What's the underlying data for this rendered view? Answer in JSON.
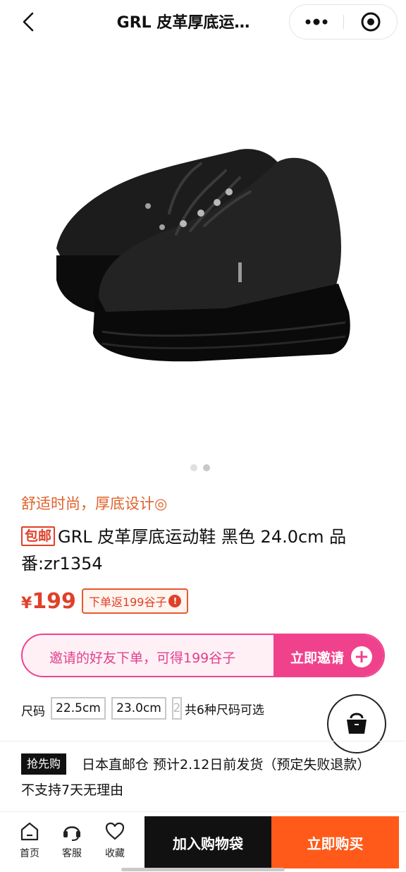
{
  "header": {
    "title": "GRL 皮革厚底运…"
  },
  "gallery": {
    "image_count": 2,
    "active_index": 1
  },
  "product": {
    "slogan": "舒适时尚，厚底设计◎",
    "badge": "包邮",
    "name": "GRL 皮革厚底运动鞋 黑色 24.0cm 品番:zr1354",
    "price_symbol": "¥",
    "price": "199",
    "rebate": "下单返199谷子",
    "rebate_icon": "!"
  },
  "invite": {
    "text": "邀请的好友下单，可得199谷子",
    "button": "立即邀请",
    "plus": "+"
  },
  "sizes": {
    "label": "尺码",
    "options": [
      "22.5cm",
      "23.0cm",
      "2"
    ],
    "count": "共6种尺码可选"
  },
  "shipping": {
    "tag": "抢先购",
    "text": "日本直邮仓 预计2.12日前发货（预定失败退款） 不支持7天无理由"
  },
  "bottom": {
    "home": "首页",
    "service": "客服",
    "favorite": "收藏",
    "add_cart": "加入购物袋",
    "buy_now": "立即购买"
  },
  "colors": {
    "accent_orange": "#ff5a1a",
    "price_red": "#e0402a",
    "invite_pink": "#f0428c"
  }
}
